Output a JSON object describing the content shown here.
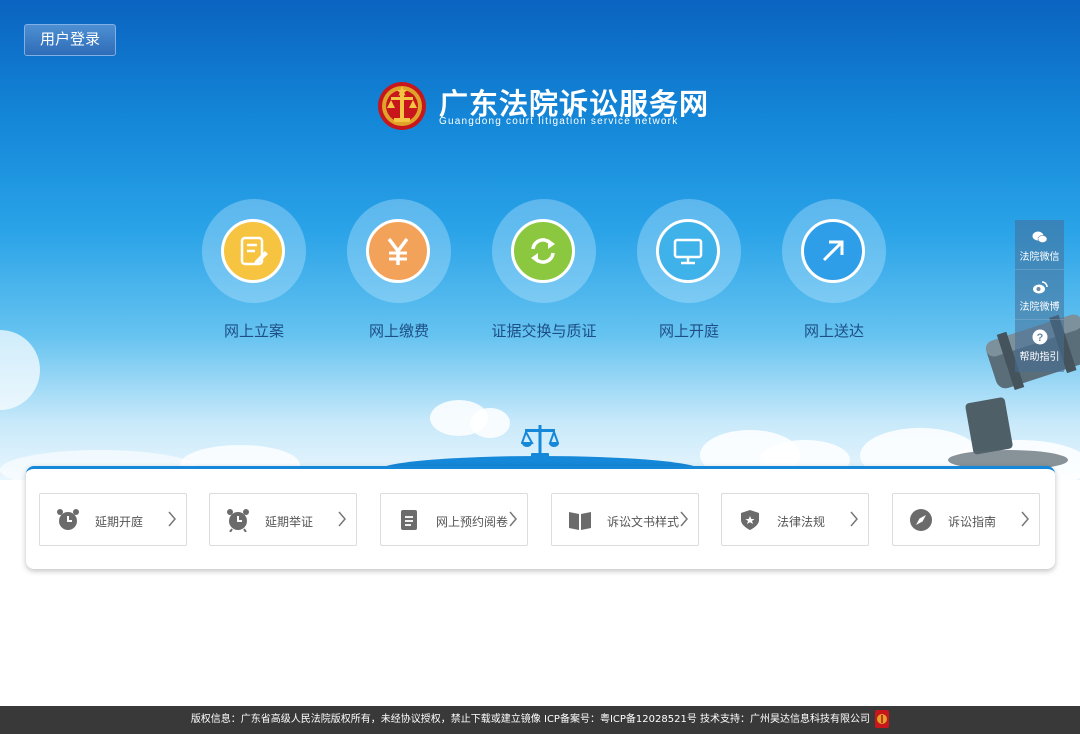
{
  "header": {
    "login_label": "用户登录",
    "brand_title": "广东法院诉讼服务网",
    "brand_subtitle": "Guangdong court litigation service network"
  },
  "services": [
    {
      "label": "网上立案",
      "icon": "document-edit-icon",
      "color": "#f6c441"
    },
    {
      "label": "网上缴费",
      "icon": "yen-icon",
      "color": "#f3a25a"
    },
    {
      "label": "证据交换与质证",
      "icon": "exchange-arrows-icon",
      "color": "#8cc83f"
    },
    {
      "label": "网上开庭",
      "icon": "monitor-icon",
      "color": "#3fb2ea"
    },
    {
      "label": "网上送达",
      "icon": "send-arrow-icon",
      "color": "#2f9ee8"
    }
  ],
  "side_panel": [
    {
      "label": "法院微信",
      "icon": "wechat-icon"
    },
    {
      "label": "法院微博",
      "icon": "weibo-icon"
    },
    {
      "label": "帮助指引",
      "icon": "help-icon"
    }
  ],
  "quick_links": [
    {
      "label": "延期开庭",
      "icon": "alarm-clock-icon"
    },
    {
      "label": "延期举证",
      "icon": "alarm-clock-icon"
    },
    {
      "label": "网上预约阅卷",
      "icon": "clipboard-icon"
    },
    {
      "label": "诉讼文书样式",
      "icon": "book-icon"
    },
    {
      "label": "法律法规",
      "icon": "shield-star-icon"
    },
    {
      "label": "诉讼指南",
      "icon": "compass-icon"
    }
  ],
  "footer": {
    "text": "版权信息：广东省高级人民法院版权所有，未经协议授权，禁止下载或建立镜像 ICP备案号：粤ICP备12028521号 技术支持：广州昊达信息科技有限公司"
  },
  "colors": {
    "sky_top": "#0a63c0",
    "accent_blue": "#1588d9",
    "label_blue": "#1d4f86",
    "footer_bg": "#393939"
  }
}
